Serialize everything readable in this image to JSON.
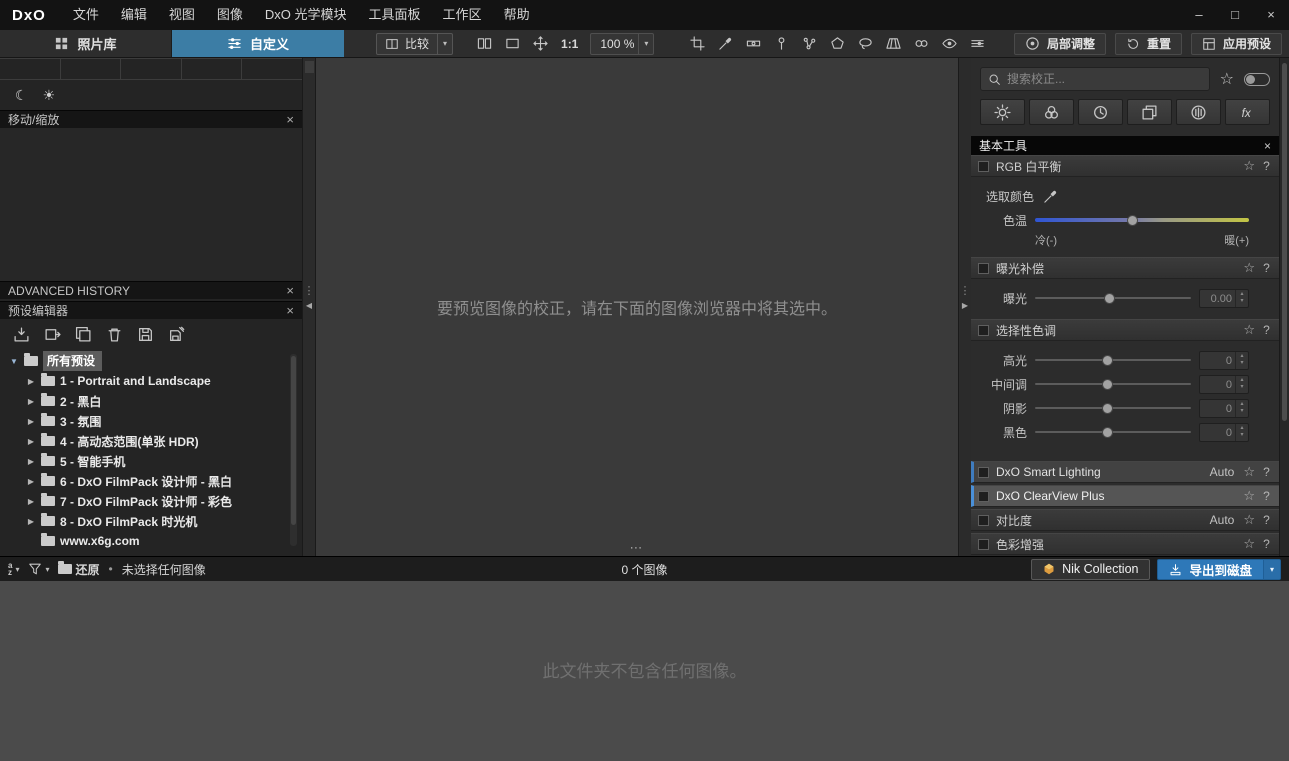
{
  "icons": {
    "minimize": "–",
    "maximize": "□",
    "close": "×",
    "dropdown": "▾",
    "arrow_collapsed": "▶",
    "arrow_expanded": "▼",
    "collapse_left": "◀",
    "collapse_right": "▶",
    "moon": "☾",
    "sun": "☀",
    "star": "☆",
    "help": "?",
    "handle_dots": "⋮",
    "splitter_dots": "⋯",
    "bullet": "•",
    "spin_up": "▴",
    "spin_down": "▾",
    "fx": "fx",
    "sort_a": "a",
    "sort_z": "z"
  },
  "menubar": {
    "logo": "DxO",
    "items": [
      "文件",
      "编辑",
      "视图",
      "图像",
      "DxO 光学模块",
      "工具面板",
      "工作区",
      "帮助"
    ]
  },
  "toolbar": {
    "tab_photolibrary": "照片库",
    "tab_customize": "自定义",
    "compare": "比较",
    "ratio": "1:1",
    "zoom": "100 %",
    "local_adjust": "局部调整",
    "reset": "重置",
    "apply_preset": "应用预设"
  },
  "left_panel": {
    "move_zoom_title": "移动/缩放",
    "history_title": "ADVANCED HISTORY",
    "preset_editor_title": "预设编辑器",
    "tree": [
      {
        "label": "所有预设"
      },
      {
        "label": "1 - Portrait and Landscape"
      },
      {
        "label": "2 - 黑白"
      },
      {
        "label": "3 - 氛围"
      },
      {
        "label": "4 - 高动态范围(单张 HDR)"
      },
      {
        "label": "5 - 智能手机"
      },
      {
        "label": "6 - DxO FilmPack 设计师 - 黑白"
      },
      {
        "label": "7 - DxO FilmPack 设计师 - 彩色"
      },
      {
        "label": "8 - DxO FilmPack 时光机"
      },
      {
        "label": "www.x6g.com"
      }
    ]
  },
  "viewer": {
    "empty_message": "要预览图像的校正，请在下面的图像浏览器中将其选中。"
  },
  "right_panel": {
    "search_placeholder": "搜索校正...",
    "palette_title": "基本工具",
    "white_balance": {
      "title": "RGB 白平衡",
      "pick_color": "选取颜色",
      "temperature": "色温",
      "cold": "冷(-)",
      "warm": "暖(+)"
    },
    "exposure": {
      "title": "曝光补偿",
      "label": "曝光",
      "value": "0.00"
    },
    "selective_tone": {
      "title": "选择性色调",
      "rows": [
        {
          "label": "高光",
          "value": "0"
        },
        {
          "label": "中间调",
          "value": "0"
        },
        {
          "label": "阴影",
          "value": "0"
        },
        {
          "label": "黑色",
          "value": "0"
        }
      ]
    },
    "smart_lighting": {
      "title": "DxO Smart Lighting",
      "mode": "Auto"
    },
    "clearview": {
      "title": "DxO ClearView Plus"
    },
    "contrast": {
      "title": "对比度",
      "mode": "Auto"
    },
    "color_enhance": {
      "title": "色彩增强"
    }
  },
  "statusbar": {
    "restore": "还原",
    "selection": "未选择任何图像",
    "image_count": "0 个图像",
    "nik": "Nik Collection",
    "export": "导出到磁盘"
  },
  "browser": {
    "empty_message": "此文件夹不包含任何图像。"
  }
}
